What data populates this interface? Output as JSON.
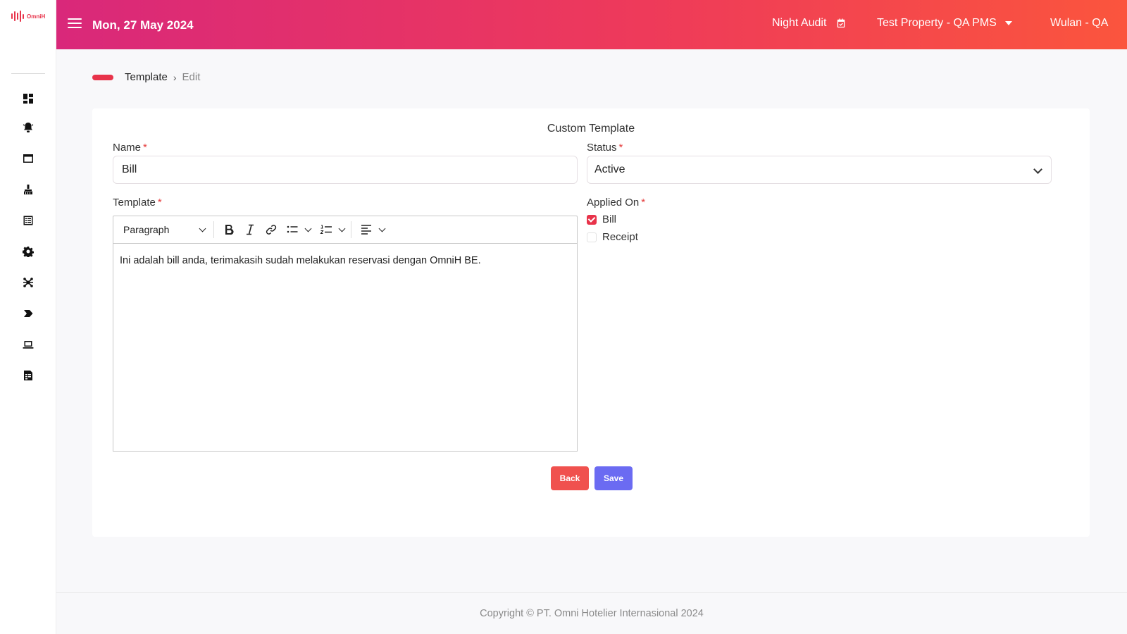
{
  "brand": {
    "logo_text": "OmniH",
    "accent": "#e8334a"
  },
  "header": {
    "date": "Mon, 27 May 2024",
    "night_audit": "Night Audit",
    "property": "Test Property - QA PMS",
    "user": "Wulan - QA",
    "gradient": [
      "#d9287a",
      "#ee3a5a",
      "#fb553d"
    ]
  },
  "sidebar": {
    "icons": [
      "dashboard-icon",
      "alert-bell-icon",
      "window-icon",
      "housekeeping-icon",
      "list-icon",
      "settings-gear-icon",
      "integration-icon",
      "arrow-tag-icon",
      "laptop-icon",
      "report-document-icon"
    ]
  },
  "breadcrumb": {
    "parent": "Template",
    "separator": "›",
    "current": "Edit"
  },
  "form": {
    "title": "Custom Template",
    "name_label": "Name",
    "name_value": "Bill",
    "status_label": "Status",
    "status_value": "Active",
    "template_label": "Template",
    "applied_on_label": "Applied On",
    "required_mark": "*",
    "applied_on": [
      {
        "label": "Bill",
        "checked": true
      },
      {
        "label": "Receipt",
        "checked": false
      }
    ]
  },
  "editor": {
    "heading_select": "Paragraph",
    "toolbar_icons": [
      "bold-icon",
      "italic-icon",
      "link-icon",
      "bulleted-list-icon",
      "numbered-list-icon",
      "align-icon"
    ],
    "content": "Ini adalah bill anda, terimakasih sudah melakukan reservasi dengan OmniH BE."
  },
  "actions": {
    "back_label": "Back",
    "save_label": "Save",
    "back_color": "#f0514e",
    "save_color": "#6b6bf2"
  },
  "footer": {
    "copyright": "Copyright © PT. Omni Hotelier Internasional 2024"
  }
}
